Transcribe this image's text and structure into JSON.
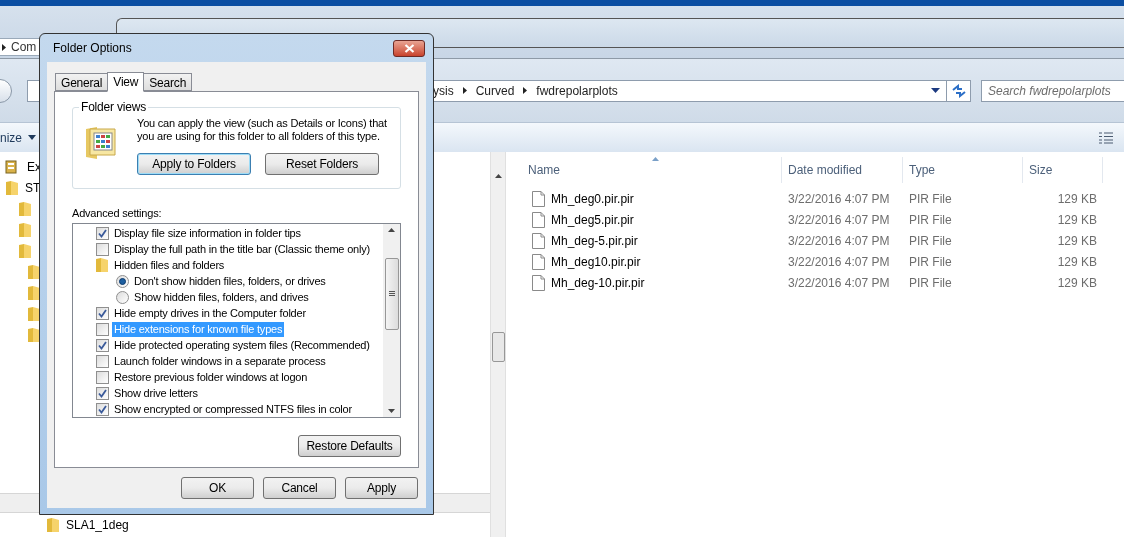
{
  "explorer": {
    "back_path": "Com",
    "address": [
      "ysis",
      "Curved",
      "fwdrepolarplots"
    ],
    "search": {
      "placeholder": "Search fwdrepolarplots"
    },
    "toolbar_label": "nize",
    "nav_items": [
      {
        "label": "Ex",
        "kind": "computer"
      },
      {
        "label": "ST",
        "kind": "folder"
      }
    ],
    "nav_bottom": "SLA1_1deg",
    "columns": [
      {
        "label": "Name",
        "sorted": true
      },
      {
        "label": "Date modified",
        "sorted": false
      },
      {
        "label": "Type",
        "sorted": false
      },
      {
        "label": "Size",
        "sorted": false
      }
    ],
    "files": [
      {
        "name": "Mh_deg0.pir.pir",
        "date": "3/22/2016 4:07 PM",
        "type": "PIR File",
        "size": "129 KB"
      },
      {
        "name": "Mh_deg5.pir.pir",
        "date": "3/22/2016 4:07 PM",
        "type": "PIR File",
        "size": "129 KB"
      },
      {
        "name": "Mh_deg-5.pir.pir",
        "date": "3/22/2016 4:07 PM",
        "type": "PIR File",
        "size": "129 KB"
      },
      {
        "name": "Mh_deg10.pir.pir",
        "date": "3/22/2016 4:07 PM",
        "type": "PIR File",
        "size": "129 KB"
      },
      {
        "name": "Mh_deg-10.pir.pir",
        "date": "3/22/2016 4:07 PM",
        "type": "PIR File",
        "size": "129 KB"
      }
    ]
  },
  "dialog": {
    "title": "Folder Options",
    "tabs": [
      {
        "label": "General",
        "selected": false
      },
      {
        "label": "View",
        "selected": true
      },
      {
        "label": "Search",
        "selected": false
      }
    ],
    "folder_views": {
      "title": "Folder views",
      "text": "You can apply the view (such as Details or Icons) that you are using for this folder to all folders of this type.",
      "buttons": [
        {
          "label": "Apply to Folders",
          "default": true
        },
        {
          "label": "Reset Folders",
          "default": false
        }
      ]
    },
    "advanced_label": "Advanced settings:",
    "settings": [
      {
        "kind": "checkbox",
        "label": "Display file size information in folder tips",
        "checked": true,
        "selected": false
      },
      {
        "kind": "checkbox",
        "label": "Display the full path in the title bar (Classic theme only)",
        "checked": false,
        "selected": false
      },
      {
        "kind": "folder",
        "label": "Hidden files and folders",
        "selected": false,
        "children": [
          {
            "kind": "radio",
            "label": "Don't show hidden files, folders, or drives",
            "checked": true,
            "selected": false
          },
          {
            "kind": "radio",
            "label": "Show hidden files, folders, and drives",
            "checked": false,
            "selected": false
          }
        ]
      },
      {
        "kind": "checkbox",
        "label": "Hide empty drives in the Computer folder",
        "checked": true,
        "selected": false
      },
      {
        "kind": "checkbox",
        "label": "Hide extensions for known file types",
        "checked": false,
        "selected": true
      },
      {
        "kind": "checkbox",
        "label": "Hide protected operating system files (Recommended)",
        "checked": true,
        "selected": false
      },
      {
        "kind": "checkbox",
        "label": "Launch folder windows in a separate process",
        "checked": false,
        "selected": false
      },
      {
        "kind": "checkbox",
        "label": "Restore previous folder windows at logon",
        "checked": false,
        "selected": false
      },
      {
        "kind": "checkbox",
        "label": "Show drive letters",
        "checked": true,
        "selected": false
      },
      {
        "kind": "checkbox",
        "label": "Show encrypted or compressed NTFS files in color",
        "checked": true,
        "selected": false
      }
    ],
    "restore_button": "Restore Defaults",
    "footer_buttons": [
      "OK",
      "Cancel",
      "Apply"
    ]
  }
}
